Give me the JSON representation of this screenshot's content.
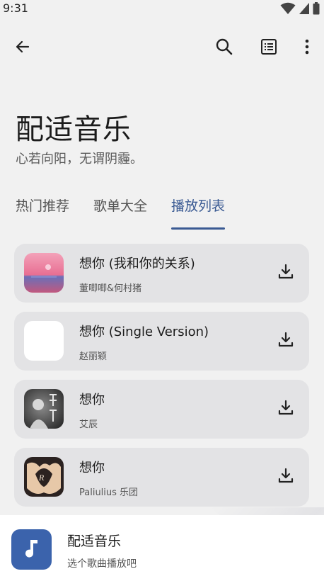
{
  "status_bar": {
    "time": "9:31",
    "icons": [
      "wifi-icon",
      "signal-icon",
      "battery-icon"
    ]
  },
  "app_bar": {
    "icons": [
      "back-arrow-icon",
      "search-icon",
      "list-view-icon",
      "more-vert-icon"
    ]
  },
  "header": {
    "title": "配适音乐",
    "subtitle": "心若向阳，无谓阴霾。"
  },
  "tabs": [
    {
      "label": "热门推荐",
      "active": false
    },
    {
      "label": "歌单大全",
      "active": false
    },
    {
      "label": "播放列表",
      "active": true
    }
  ],
  "songs": [
    {
      "title": "想你 (我和你的关系)",
      "artist": "董唧唧&何村猪",
      "cover": "pink-sunset-cover"
    },
    {
      "title": "想你 (Single Version)",
      "artist": "赵丽颖",
      "cover": "blank-white-cover"
    },
    {
      "title": "想你",
      "artist": "艾辰",
      "cover": "dark-portrait-cover"
    },
    {
      "title": "想你",
      "artist": "Paliulius 乐团",
      "cover": "heart-hands-cover"
    }
  ],
  "now_playing": {
    "title": "配适音乐",
    "subtitle": "选个歌曲播放吧",
    "icon": "music-note-icon"
  },
  "colors": {
    "background": "#f1f1f1",
    "card": "#e3e3e5",
    "accent": "#3a5a93",
    "player_art": "#3b63ac"
  }
}
